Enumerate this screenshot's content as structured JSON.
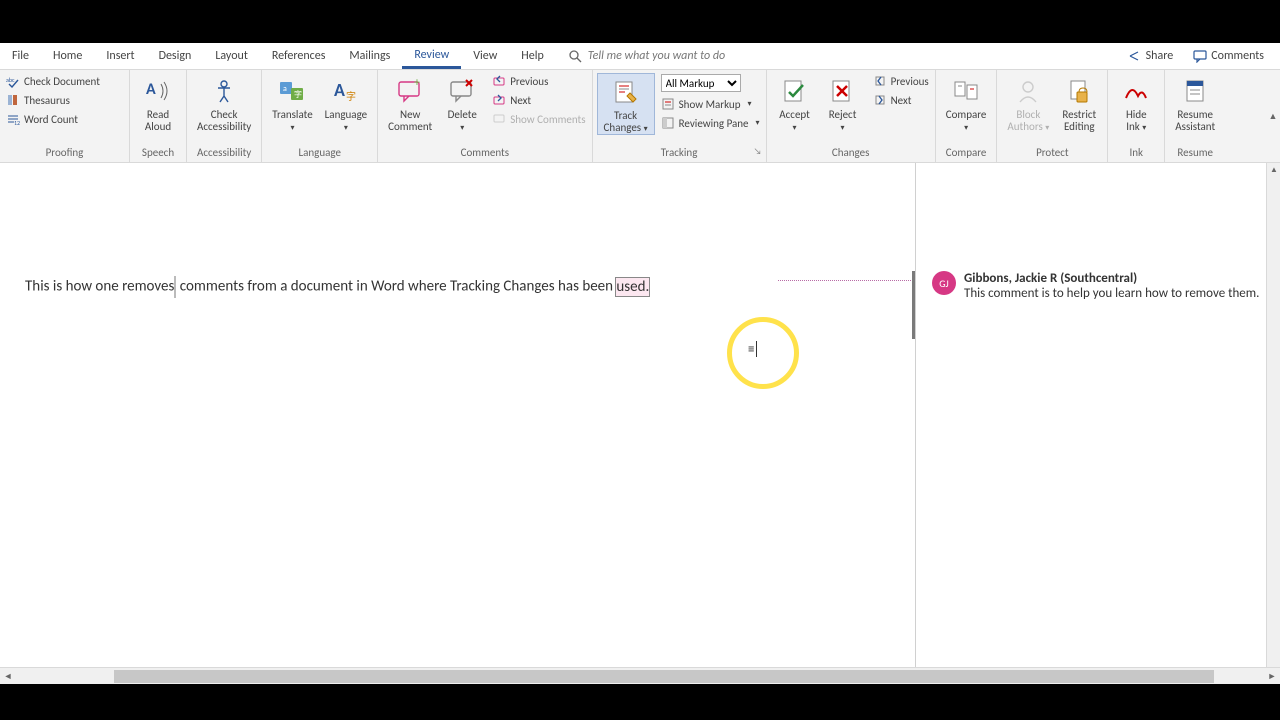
{
  "menu": {
    "tabs": [
      "File",
      "Home",
      "Insert",
      "Design",
      "Layout",
      "References",
      "Mailings",
      "Review",
      "View",
      "Help"
    ],
    "active": 7,
    "search_placeholder": "Tell me what you want to do",
    "share": "Share",
    "comments": "Comments"
  },
  "ribbon": {
    "proofing": {
      "title": "Proofing",
      "check_doc": "Check Document",
      "thesaurus": "Thesaurus",
      "word_count": "Word Count"
    },
    "speech": {
      "title": "Speech",
      "read_aloud": "Read\nAloud"
    },
    "accessibility": {
      "title": "Accessibility",
      "check": "Check\nAccessibility"
    },
    "language": {
      "title": "Language",
      "translate": "Translate",
      "language": "Language"
    },
    "comments": {
      "title": "Comments",
      "new_comment": "New\nComment",
      "delete": "Delete",
      "previous": "Previous",
      "next": "Next",
      "show": "Show Comments"
    },
    "tracking": {
      "title": "Tracking",
      "track_changes": "Track\nChanges",
      "markup_mode": "All Markup",
      "show_markup": "Show Markup",
      "reviewing_pane": "Reviewing Pane"
    },
    "changes": {
      "title": "Changes",
      "accept": "Accept",
      "reject": "Reject",
      "previous": "Previous",
      "next": "Next"
    },
    "compare": {
      "title": "Compare",
      "compare": "Compare"
    },
    "protect": {
      "title": "Protect",
      "block_authors": "Block\nAuthors",
      "restrict": "Restrict\nEditing"
    },
    "ink": {
      "title": "Ink",
      "hide_ink": "Hide\nInk"
    },
    "resume": {
      "title": "Resume",
      "assistant": "Resume\nAssistant"
    }
  },
  "document": {
    "paragraph": "This is how one removes comments from a document in Word where Tracking Changes has been used."
  },
  "comment": {
    "avatar": "GJ",
    "author": "Gibbons, Jackie R (Southcentral)",
    "body": "This comment is to help you learn how to remove them."
  }
}
